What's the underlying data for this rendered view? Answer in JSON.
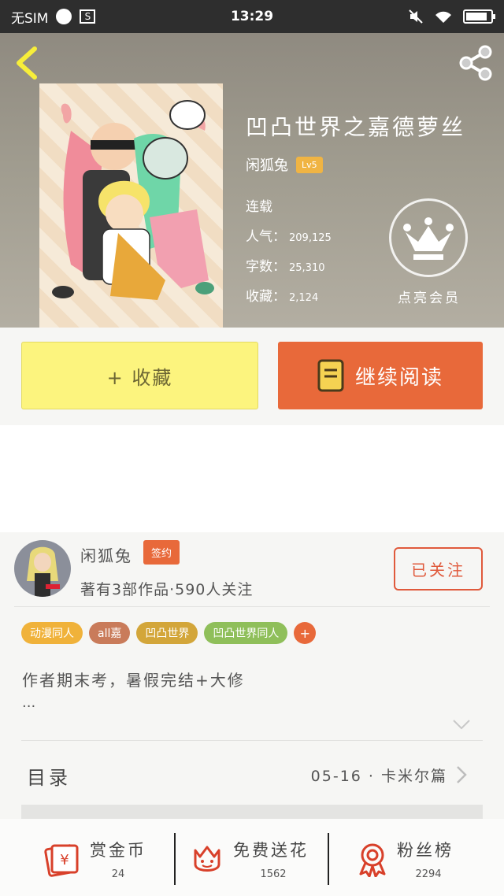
{
  "status_bar": {
    "carrier": "无SIM",
    "time": "13:29",
    "sim_icon_text": "S"
  },
  "book": {
    "title": "凹凸世界之嘉德萝丝",
    "author": "闲狐兔",
    "author_level": "Lv5",
    "status": "连载",
    "popularity_label": "人气：",
    "popularity": "209,125",
    "word_count_label": "字数：",
    "word_count": "25,310",
    "favorites_label": "收藏：",
    "favorites": "2,124",
    "vip_label": "点亮会员"
  },
  "actions": {
    "collect_label": "+ 收藏",
    "read_label": "继续阅读"
  },
  "author_card": {
    "name": "闲狐兔",
    "signed_badge": "签约",
    "stats": "著有3部作品·590人关注",
    "follow_label": "已关注"
  },
  "tags": [
    {
      "label": "动漫同人",
      "color": "#f0b23a"
    },
    {
      "label": "all嘉",
      "color": "#c97b5a"
    },
    {
      "label": "凹凸世界",
      "color": "#d3a63a"
    },
    {
      "label": "凹凸世界同人",
      "color": "#8fbf5a"
    }
  ],
  "tag_add_label": "+",
  "description": "作者期末考，暑假完结+大修",
  "description_more": "...",
  "toc": {
    "label": "目录",
    "latest": "05-16 · 卡米尔篇"
  },
  "bottom_stats": [
    {
      "label": "赏金币",
      "value": "24",
      "icon": "red-envelope-yen-icon"
    },
    {
      "label": "免费送花",
      "value": "1562",
      "icon": "flower-icon"
    },
    {
      "label": "粉丝榜",
      "value": "2294",
      "icon": "award-medal-icon"
    }
  ],
  "colors": {
    "accent_orange": "#e8693a",
    "collect_yellow": "#fcf47e",
    "follow_red": "#e05a3c"
  }
}
